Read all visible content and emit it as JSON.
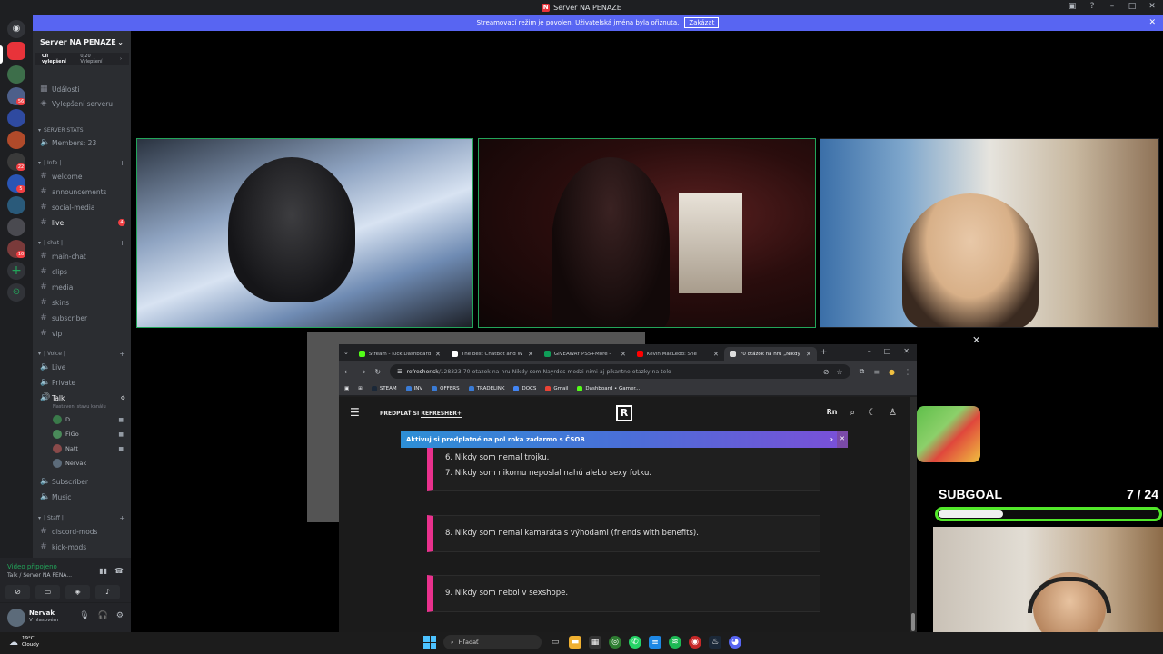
{
  "window": {
    "title": "Server NA PENAZE"
  },
  "banner": {
    "text": "Streamovací režim je povolen. Uživatelská jména byla ořiznuta.",
    "button": "Zakázat"
  },
  "server": {
    "name": "Server NA PENAZE",
    "boost_goal": "Cíl vylepšení",
    "boost_count": "0/20 Vylepšení",
    "events": "Události",
    "upgrades": "Vylepšení serveru"
  },
  "categories": {
    "stats": "SERVER STATS",
    "info": "| Info |",
    "chat": "| chat |",
    "voice": "| Voice |",
    "staff": "| Staff |"
  },
  "channels": {
    "members": "Members: 23",
    "welcome": "welcome",
    "announcements": "announcements",
    "social_media": "social-media",
    "live": "live",
    "live_badge": "4",
    "main_chat": "main-chat",
    "clips": "clips",
    "media": "media",
    "skins": "skins",
    "subscriber": "subscriber",
    "vip": "vip",
    "v_live": "Live",
    "v_private": "Private",
    "v_talk": "Talk",
    "v_talk_status": "Nastavení stavu kanálu",
    "v_subscriber": "Subscriber",
    "v_music": "Music",
    "discord_mods": "discord-mods",
    "kick_mods": "kick-mods"
  },
  "voice_users": [
    "D...",
    "FIGo",
    "Natt",
    "Nervak"
  ],
  "voice_panel": {
    "title": "Video připojeno",
    "sub": "Talk / Server NA PENA..."
  },
  "user": {
    "name": "Nervak",
    "status": "V hlasovém"
  },
  "browser": {
    "tabs": [
      {
        "label": "Stream - Kick Dashboard",
        "color": "#53fc18"
      },
      {
        "label": "The best ChatBot and W",
        "color": "#ffffff"
      },
      {
        "label": "GIVEAWAY PS5+More -",
        "color": "#0f9d58"
      },
      {
        "label": "Kevin MacLeod: Sne",
        "color": "#ff0000"
      },
      {
        "label": "70 otázok na hru „Nikdy",
        "color": "#dddddd"
      }
    ],
    "url_host": "refresher.sk",
    "url_path": "/128323-70-otazok-na-hru-Nikdy-som-Nayrdes-medzi-nimi-aj-pikantne-otazky-na-telo",
    "bookmarks": [
      {
        "label": "STEAM",
        "color": "#1b2838"
      },
      {
        "label": "INV",
        "color": "#3a7bd5"
      },
      {
        "label": "OFFERS",
        "color": "#3a7bd5"
      },
      {
        "label": "TRADELINK",
        "color": "#3a7bd5"
      },
      {
        "label": "DOCS",
        "color": "#4285f4"
      },
      {
        "label": "Gmail",
        "color": "#ea4335"
      },
      {
        "label": "Dashboard • Gamer...",
        "color": "#53fc18"
      }
    ]
  },
  "site": {
    "subscribe_prefix": "PREDPLAŤ SI",
    "subscribe_brand": "REFRESHER+",
    "logo": "R",
    "promo": "Aktivuj si predplatné na pol roka zadarmo s ČSOB",
    "q6": "6. Nikdy som nemal trojku.",
    "q7": "7. Nikdy som nikomu neposlal nahú alebo sexy fotku.",
    "q8": "8. Nikdy som nemal kamaráta s výhodami (friends with benefits).",
    "q9": "9. Nikdy som nebol v sexshope."
  },
  "subgoal": {
    "label": "SUBGOAL",
    "count": "7 / 24",
    "current": 7,
    "target": 24
  },
  "weather": {
    "temp": "19°C",
    "cond": "Cloudy"
  },
  "taskbar": {
    "search": "Hľadať"
  }
}
